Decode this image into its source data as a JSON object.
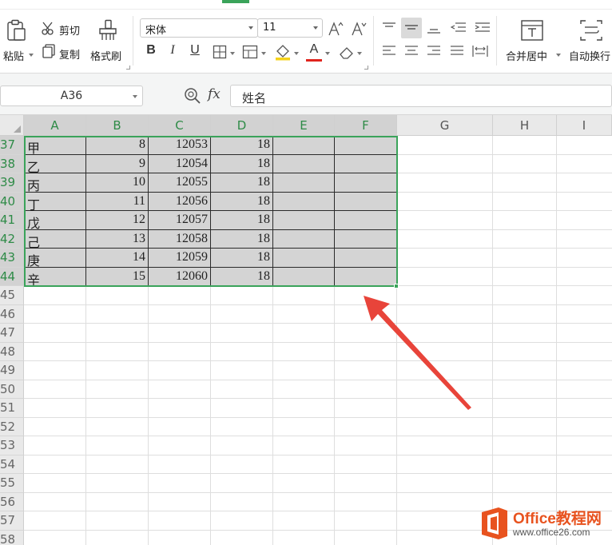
{
  "ribbon": {
    "paste_label": "粘贴",
    "cut_label": "剪切",
    "copy_label": "复制",
    "format_painter_label": "格式刷",
    "font_name": "宋体",
    "font_size": "11",
    "bold_label": "B",
    "italic_label": "I",
    "underline_label": "U",
    "font_color_label": "A",
    "merge_center_label": "合并居中",
    "wrap_text_label": "自动换行"
  },
  "formula_bar": {
    "name_box": "A36",
    "fx_label": "fx",
    "formula": "姓名"
  },
  "sheet": {
    "columns": [
      "A",
      "B",
      "C",
      "D",
      "E",
      "F",
      "G",
      "H",
      "I"
    ],
    "row_numbers": [
      "37",
      "38",
      "39",
      "40",
      "41",
      "42",
      "43",
      "44",
      "45",
      "46",
      "47",
      "48",
      "49",
      "50",
      "51",
      "52",
      "53",
      "54",
      "55",
      "56",
      "57",
      "58"
    ],
    "rows": [
      [
        "甲",
        "8",
        "12053",
        "18"
      ],
      [
        "乙",
        "9",
        "12054",
        "18"
      ],
      [
        "丙",
        "10",
        "12055",
        "18"
      ],
      [
        "丁",
        "11",
        "12056",
        "18"
      ],
      [
        "戊",
        "12",
        "12057",
        "18"
      ],
      [
        "己",
        "13",
        "12058",
        "18"
      ],
      [
        "庚",
        "14",
        "12059",
        "18"
      ],
      [
        "辛",
        "15",
        "12060",
        "18"
      ]
    ]
  },
  "watermark": {
    "title": "Office教程网",
    "url": "www.office26.com"
  },
  "colors": {
    "accent_green": "#3aa35a",
    "selection_fill": "#d4d4d4",
    "arrow_red": "#e8443a",
    "brand_orange": "#e8531f"
  }
}
